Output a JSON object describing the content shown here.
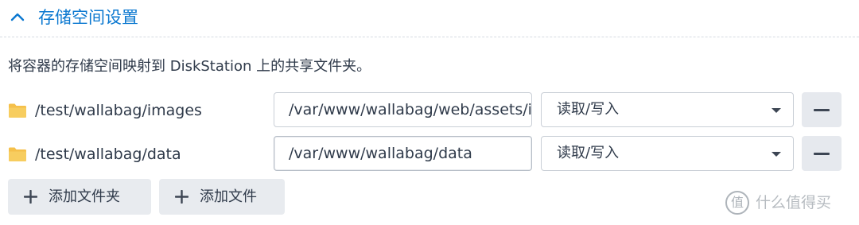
{
  "section": {
    "title": "存储空间设置",
    "description": "将容器的存储空间映射到 DiskStation 上的共享文件夹。"
  },
  "mounts": [
    {
      "host_path": "/test/wallabag/images",
      "mount_path": "/var/www/wallabag/web/assets/images",
      "permission": "读取/写入"
    },
    {
      "host_path": "/test/wallabag/data",
      "mount_path": "/var/www/wallabag/data",
      "permission": "读取/写入"
    }
  ],
  "buttons": {
    "add_folder": "添加文件夹",
    "add_file": "添加文件"
  },
  "watermark": {
    "icon_char": "值",
    "text": "什么值得买"
  },
  "colors": {
    "accent": "#0b78d0",
    "folder": "#f5c04a",
    "button_bg": "#e6e9ee"
  },
  "icons": [
    "chevron-up-icon",
    "folder-icon",
    "caret-down-icon",
    "minus-icon",
    "plus-icon"
  ]
}
